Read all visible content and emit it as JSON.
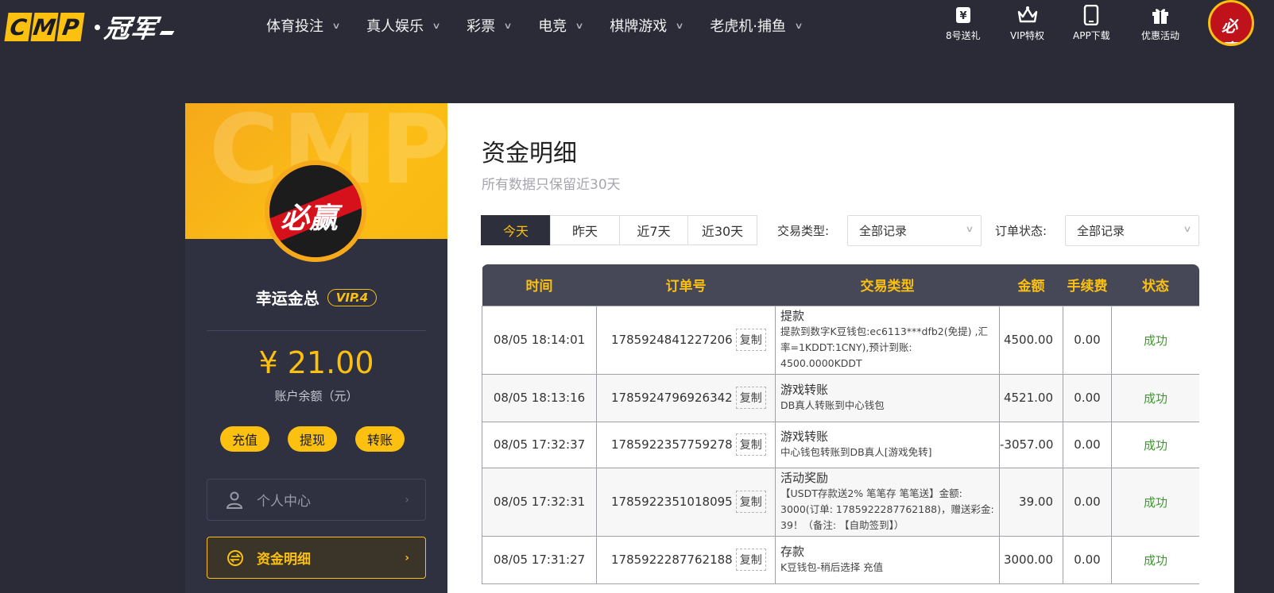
{
  "brand": {
    "logo_letters": [
      "C",
      "M",
      "P"
    ],
    "logo_cn": "冠军",
    "avatar_text": "必赢"
  },
  "nav": [
    {
      "label": "体育投注"
    },
    {
      "label": "真人娱乐"
    },
    {
      "label": "彩票"
    },
    {
      "label": "电竞"
    },
    {
      "label": "棋牌游戏"
    },
    {
      "label": "老虎机·捕鱼"
    }
  ],
  "quick_links": [
    {
      "label": "8号送礼",
      "icon": "gift-ticket-icon"
    },
    {
      "label": "VIP特权",
      "icon": "crown-icon"
    },
    {
      "label": "APP下载",
      "icon": "phone-icon"
    },
    {
      "label": "优惠活动",
      "icon": "gift-box-icon"
    }
  ],
  "sidebar": {
    "watermark": "CMP",
    "username": "幸运金总",
    "vip_level": "VIP.4",
    "balance": "¥ 21.00",
    "balance_label": "账户余额（元）",
    "actions": [
      "充值",
      "提现",
      "转账"
    ],
    "menu": [
      {
        "label": "个人中心",
        "icon": "user-icon",
        "active": false
      },
      {
        "label": "资金明细",
        "icon": "coin-exchange-icon",
        "active": true
      }
    ]
  },
  "main": {
    "title": "资金明细",
    "subtitle": "所有数据只保留近30天",
    "date_tabs": [
      {
        "label": "今天",
        "active": true
      },
      {
        "label": "昨天",
        "active": false
      },
      {
        "label": "近7天",
        "active": false
      },
      {
        "label": "近30天",
        "active": false
      }
    ],
    "filters": {
      "type_label": "交易类型:",
      "type_value": "全部记录",
      "status_label": "订单状态:",
      "status_value": "全部记录"
    },
    "table": {
      "columns": [
        "时间",
        "订单号",
        "交易类型",
        "金额",
        "手续费",
        "状态"
      ],
      "copy_label": "复制",
      "rows": [
        {
          "time": "08/05 18:14:01",
          "order": "1785924841227206",
          "type_title": "提款",
          "type_desc": "提款到数字K豆钱包:ec6113***dfb2(免提) ,汇率=1KDDT:1CNY),预计到账: 4500.0000KDDT",
          "amount": "4500.00",
          "fee": "0.00",
          "status": "成功"
        },
        {
          "time": "08/05 18:13:16",
          "order": "1785924796926342",
          "type_title": "游戏转账",
          "type_desc": "DB真人转账到中心钱包",
          "amount": "4521.00",
          "fee": "0.00",
          "status": "成功"
        },
        {
          "time": "08/05 17:32:37",
          "order": "1785922357759278",
          "type_title": "游戏转账",
          "type_desc": "中心钱包转账到DB真人[游戏免转]",
          "amount": "-3057.00",
          "fee": "0.00",
          "status": "成功"
        },
        {
          "time": "08/05 17:32:31",
          "order": "1785922351018095",
          "type_title": "活动奖励",
          "type_desc": "【USDT存款送2% 笔笔存 笔笔送】金额: 3000(订单: 1785922287762188)，赠送彩金: 39！（备注: 【自助签到】）",
          "amount": "39.00",
          "fee": "0.00",
          "status": "成功"
        },
        {
          "time": "08/05 17:31:27",
          "order": "1785922287762188",
          "type_title": "存款",
          "type_desc": "K豆钱包-稍后选择 充值",
          "amount": "3000.00",
          "fee": "0.00",
          "status": "成功"
        }
      ]
    }
  },
  "colors": {
    "accent": "#fbc010",
    "dark": "#2a2b36",
    "success": "#3d9a2d"
  }
}
